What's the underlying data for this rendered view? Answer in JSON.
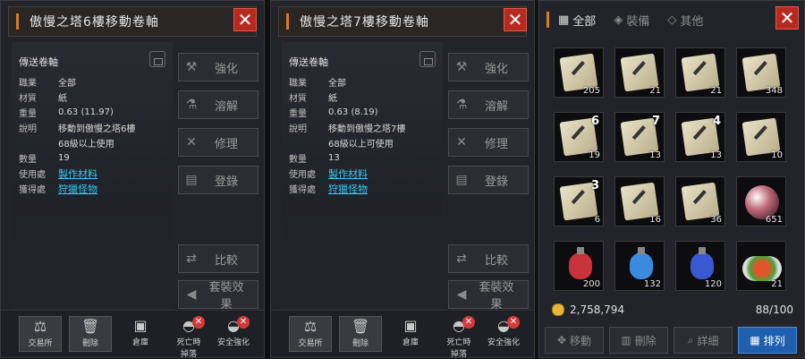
{
  "panel1": {
    "title": "傲慢之塔6樓移動卷軸",
    "item_name": "傳送卷軸",
    "fields": [
      {
        "k": "職業",
        "v": "全部"
      },
      {
        "k": "材質",
        "v": "紙"
      },
      {
        "k": "重量",
        "v": "0.63 (11.97)"
      },
      {
        "k": "說明",
        "v": "移動到傲慢之塔6樓"
      },
      {
        "k": "",
        "v": "68級以上使用"
      },
      {
        "k": "數量",
        "v": "19"
      }
    ],
    "use_label": "使用處",
    "use_link": "製作材料",
    "obtain_label": "獲得處",
    "obtain_link": "狩獵怪物",
    "buttons": [
      "強化",
      "溶解",
      "修理",
      "登錄",
      "比較",
      "套裝效果"
    ]
  },
  "panel2": {
    "title": "傲慢之塔7樓移動卷軸",
    "item_name": "傳送卷軸",
    "fields": [
      {
        "k": "職業",
        "v": "全部"
      },
      {
        "k": "材質",
        "v": "紙"
      },
      {
        "k": "重量",
        "v": "0.63 (8.19)"
      },
      {
        "k": "說明",
        "v": "移動到傲慢之塔7樓"
      },
      {
        "k": "",
        "v": "68級以上可使用"
      },
      {
        "k": "數量",
        "v": "13"
      }
    ],
    "use_label": "使用處",
    "use_link": "製作材料",
    "obtain_label": "獲得處",
    "obtain_link": "狩獵怪物",
    "buttons": [
      "強化",
      "溶解",
      "修理",
      "登錄",
      "比較",
      "套裝效果"
    ]
  },
  "bottom": {
    "exchange": "交易所",
    "delete": "刪除",
    "warehouse": "倉庫",
    "death_protect": "死亡時",
    "death_protect2": "掉落",
    "safe_enchant": "安全強化"
  },
  "inventory": {
    "tab_all": "全部",
    "tab_equip": "裝備",
    "tab_other": "其他",
    "slots": [
      {
        "q": "205"
      },
      {
        "q": "21"
      },
      {
        "q": "21"
      },
      {
        "q": "348"
      },
      {
        "q": "19",
        "f": "6"
      },
      {
        "q": "13",
        "f": "7"
      },
      {
        "q": "13",
        "f": "4"
      },
      {
        "q": "10"
      },
      {
        "q": "6",
        "f": "3"
      },
      {
        "q": "16"
      },
      {
        "q": "36"
      },
      {
        "q": "651"
      },
      {
        "q": "200"
      },
      {
        "q": "132"
      },
      {
        "q": "120"
      },
      {
        "q": "21"
      }
    ],
    "gold": "2,758,794",
    "capacity": "88/100",
    "btn_move": "移動",
    "btn_delete": "刪除",
    "btn_detail": "詳細",
    "btn_sort": "排列"
  },
  "close_glyph": "✕"
}
